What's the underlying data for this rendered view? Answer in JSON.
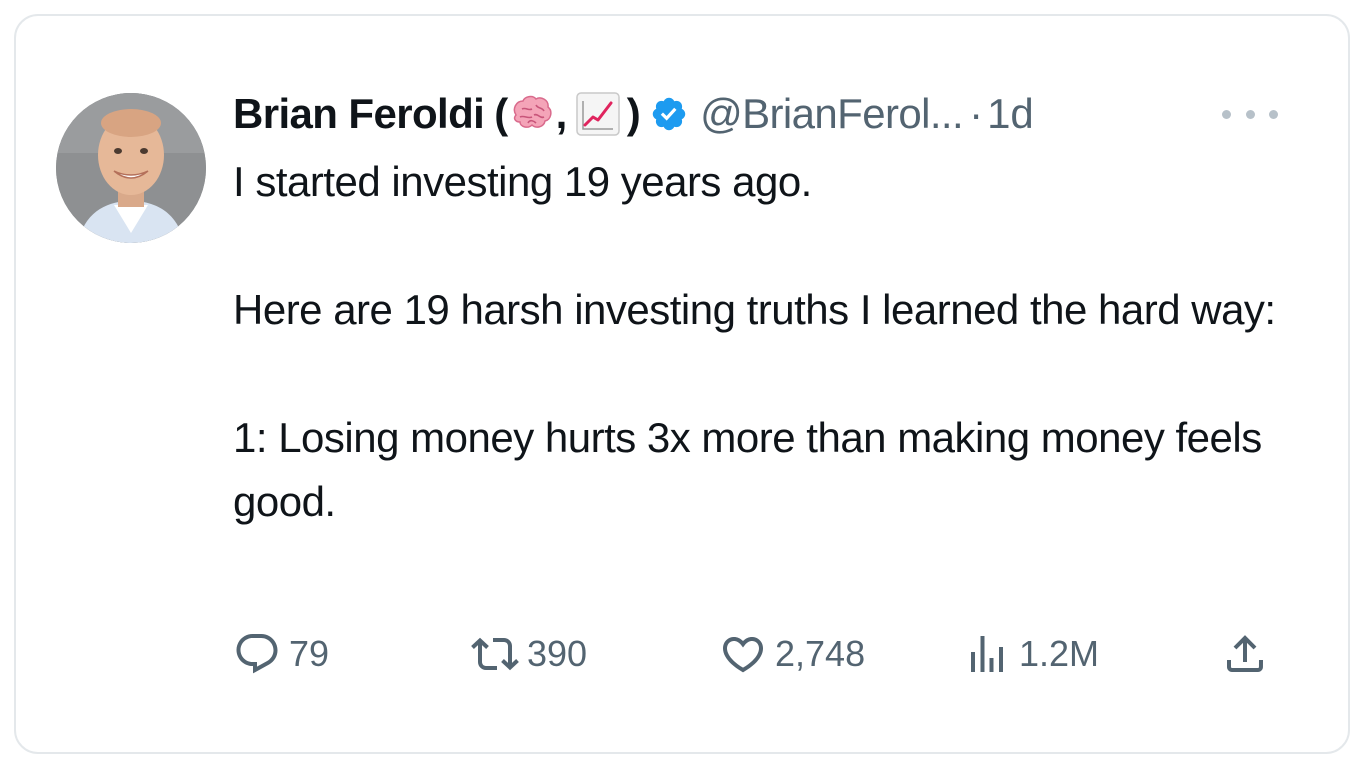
{
  "tweet": {
    "author_name": "Brian Feroldi",
    "name_prefix": "(",
    "name_comma": ",",
    "name_suffix": ")",
    "author_emojis": [
      "brain-emoji",
      "chart-increasing-emoji"
    ],
    "verified": true,
    "handle": "@BrianFerol...",
    "separator": "·",
    "time": "1d",
    "lines": [
      "I started investing 19 years ago.",
      "",
      "Here are 19 harsh investing truths I learned the hard way:",
      "",
      "1: Losing money hurts 3x more than making money feels good."
    ],
    "stats": {
      "replies": "79",
      "retweets": "390",
      "likes": "2,748",
      "views": "1.2M"
    }
  },
  "colors": {
    "text": "#0f1419",
    "secondary": "#536471",
    "verified": "#1d9bf0",
    "border": "#e4e8eb"
  },
  "icons": [
    "reply-icon",
    "retweet-icon",
    "like-icon",
    "views-icon",
    "share-icon",
    "more-icon",
    "verified-badge-icon"
  ]
}
